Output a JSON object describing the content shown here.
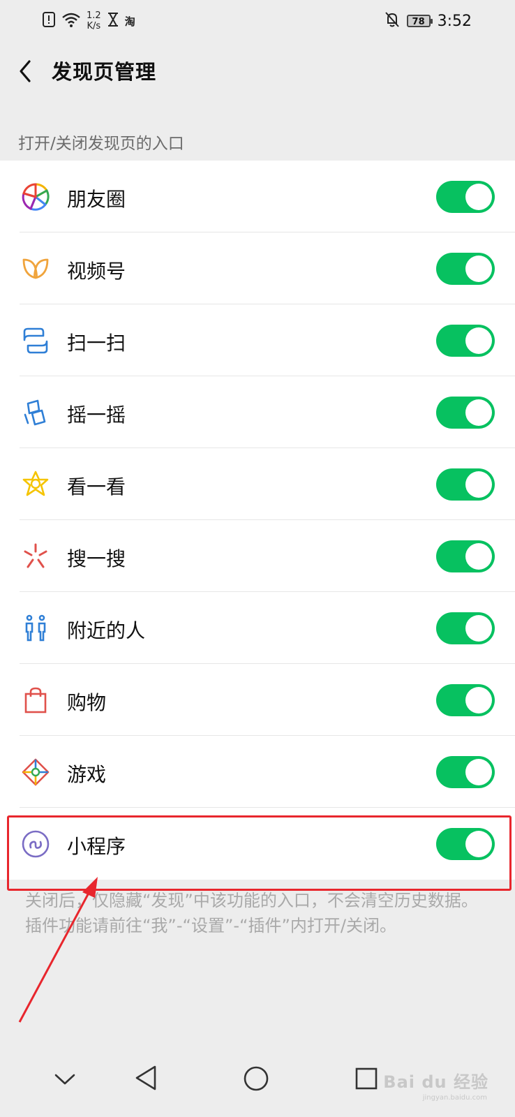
{
  "status_bar": {
    "speed_value": "1.2",
    "speed_unit": "K/s",
    "app_label": "淘",
    "battery": "78",
    "time": "3:52"
  },
  "header": {
    "title": "发现页管理"
  },
  "section_label": "打开/关闭发现页的入口",
  "items": [
    {
      "label": "朋友圈",
      "icon": "moments-icon",
      "on": true
    },
    {
      "label": "视频号",
      "icon": "channels-icon",
      "on": true
    },
    {
      "label": "扫一扫",
      "icon": "scan-icon",
      "on": true
    },
    {
      "label": "摇一摇",
      "icon": "shake-icon",
      "on": true
    },
    {
      "label": "看一看",
      "icon": "top-stories-icon",
      "on": true
    },
    {
      "label": "搜一搜",
      "icon": "search-icon",
      "on": true
    },
    {
      "label": "附近的人",
      "icon": "people-nearby-icon",
      "on": true
    },
    {
      "label": "购物",
      "icon": "shopping-icon",
      "on": true
    },
    {
      "label": "游戏",
      "icon": "games-icon",
      "on": true
    },
    {
      "label": "小程序",
      "icon": "mini-programs-icon",
      "on": true
    }
  ],
  "footnote": "关闭后，仅隐藏“发现”中该功能的入口，不会清空历史数据。插件功能请前往“我”-“设置”-“插件”内打开/关闭。",
  "watermark": {
    "text": "Bai du 经验",
    "sub": "jingyan.baidu.com"
  },
  "colors": {
    "toggle_on": "#07c160",
    "highlight": "#e8262d"
  }
}
